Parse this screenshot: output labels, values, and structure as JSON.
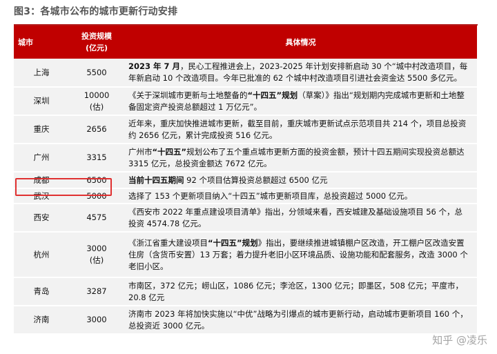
{
  "figure": {
    "title": "图3：各城市公布的城市更新行动安排"
  },
  "table": {
    "headers": {
      "city": "城市",
      "investment_line1": "投资规模",
      "investment_line2": "(亿元)",
      "details": "具体情况"
    },
    "rows": [
      {
        "city": "上海",
        "investment": "5500",
        "detail_bold": "2023 年 7 月",
        "detail_rest": "，民心工程推进会上，2023-2025 年计划安排新启动 30 个“城中村改造项目，每年新启动 10 个改造项目。今年已批准的 62 个城中村改造项目引进社会资金达 5500 多亿元。"
      },
      {
        "city": "深圳",
        "investment": "10000",
        "investment_note": "(估)",
        "detail_pre": "《关于深圳城市更新与土地整备的",
        "detail_bold": "“十四五”规划",
        "detail_rest": "（草案）》指出“规划期内完成城市更新和土地整备固定资产投资总额超过 1 万亿元”。"
      },
      {
        "city": "重庆",
        "investment": "2656",
        "detail_rest": "近年来，重庆加快推进城市更新，截至目前，重庆城市更新试点示范项目共 214 个，项目总投资约 2656 亿元，累计完成投资 516 亿元。"
      },
      {
        "city": "广州",
        "investment": "3315",
        "detail_pre": "广州市",
        "detail_bold": "“十四五”",
        "detail_rest": "规划公布了五个重点城市更新方面的投资金额，预计十四五期间实现投资总额达 3315 亿元，总投资金额达 7672 亿元。"
      },
      {
        "city": "成都",
        "investment": "6500",
        "detail_bold": "当前十四五期间",
        "detail_rest": " 92 个项目估算投资总额超过 6500 亿元"
      },
      {
        "city": "武汉",
        "investment": "5000",
        "detail_rest": "选择了 153 个更新项目纳入“十四五”城市更新项目库，总投资超过 5000 亿元。"
      },
      {
        "city": "西安",
        "investment": "4575",
        "detail_rest": "《西安市 2022 年重点建设项目清单》指出，分领域来看，西安城建及基础设施项目 56 个，总投资 4574.78 亿元。"
      },
      {
        "city": "杭州",
        "investment": "3000",
        "investment_note": "(估)",
        "detail_pre": "《浙江省重大建设项目",
        "detail_bold": "“十四五”规划",
        "detail_rest": "》指出，要继续推进城镇棚户区改造，开工棚户区改造安置住房（含货币安置）13 万套；着力提升老旧小区环境品质、设施功能和配套服务，改造 3000 个老旧小区。"
      },
      {
        "city": "青岛",
        "investment": "3287",
        "detail_rest": "市南区，372 亿元；崂山区，1086 亿元；李沧区，1300 亿元；即墨区，508 亿元；平度市，20.8 亿元"
      },
      {
        "city": "济南",
        "investment": "3000",
        "detail_rest": "济南市 2023 年将加快实施以“中优”战略为引爆点的城市更新行动，启动城市更新项目 160 个，总投资近 3000 亿元。"
      }
    ]
  },
  "watermark": {
    "text": "知乎 @凌乐"
  }
}
